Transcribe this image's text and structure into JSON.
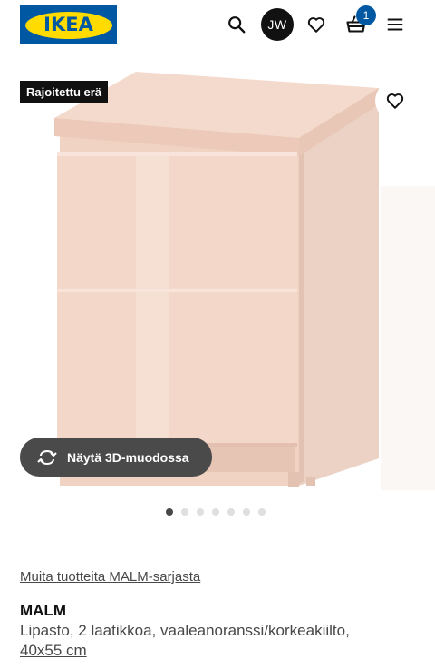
{
  "header": {
    "logo_text": "IKEA",
    "user_initials": "JW",
    "cart_count": "1"
  },
  "icons": {
    "search": "search-icon",
    "favourites": "heart-icon",
    "cart": "basket-icon",
    "menu": "hamburger-menu-icon",
    "view3d": "rotate-3d-icon"
  },
  "product": {
    "badge": "Rajoitettu erä",
    "view3d_label": "Näytä 3D-muodossa",
    "carousel_total": 7,
    "carousel_active": 1,
    "series_link": "Muita tuotteita MALM-sarjasta",
    "name": "MALM",
    "description": "Lipasto, 2 laatikkoa, vaaleanoranssi/korkeakiilto,",
    "size": "40x55 cm"
  },
  "colors": {
    "brand_blue": "#0058a3",
    "brand_yellow": "#ffdb00",
    "dresser_front": "#f2d4c4",
    "dresser_side": "#ead0c2"
  }
}
